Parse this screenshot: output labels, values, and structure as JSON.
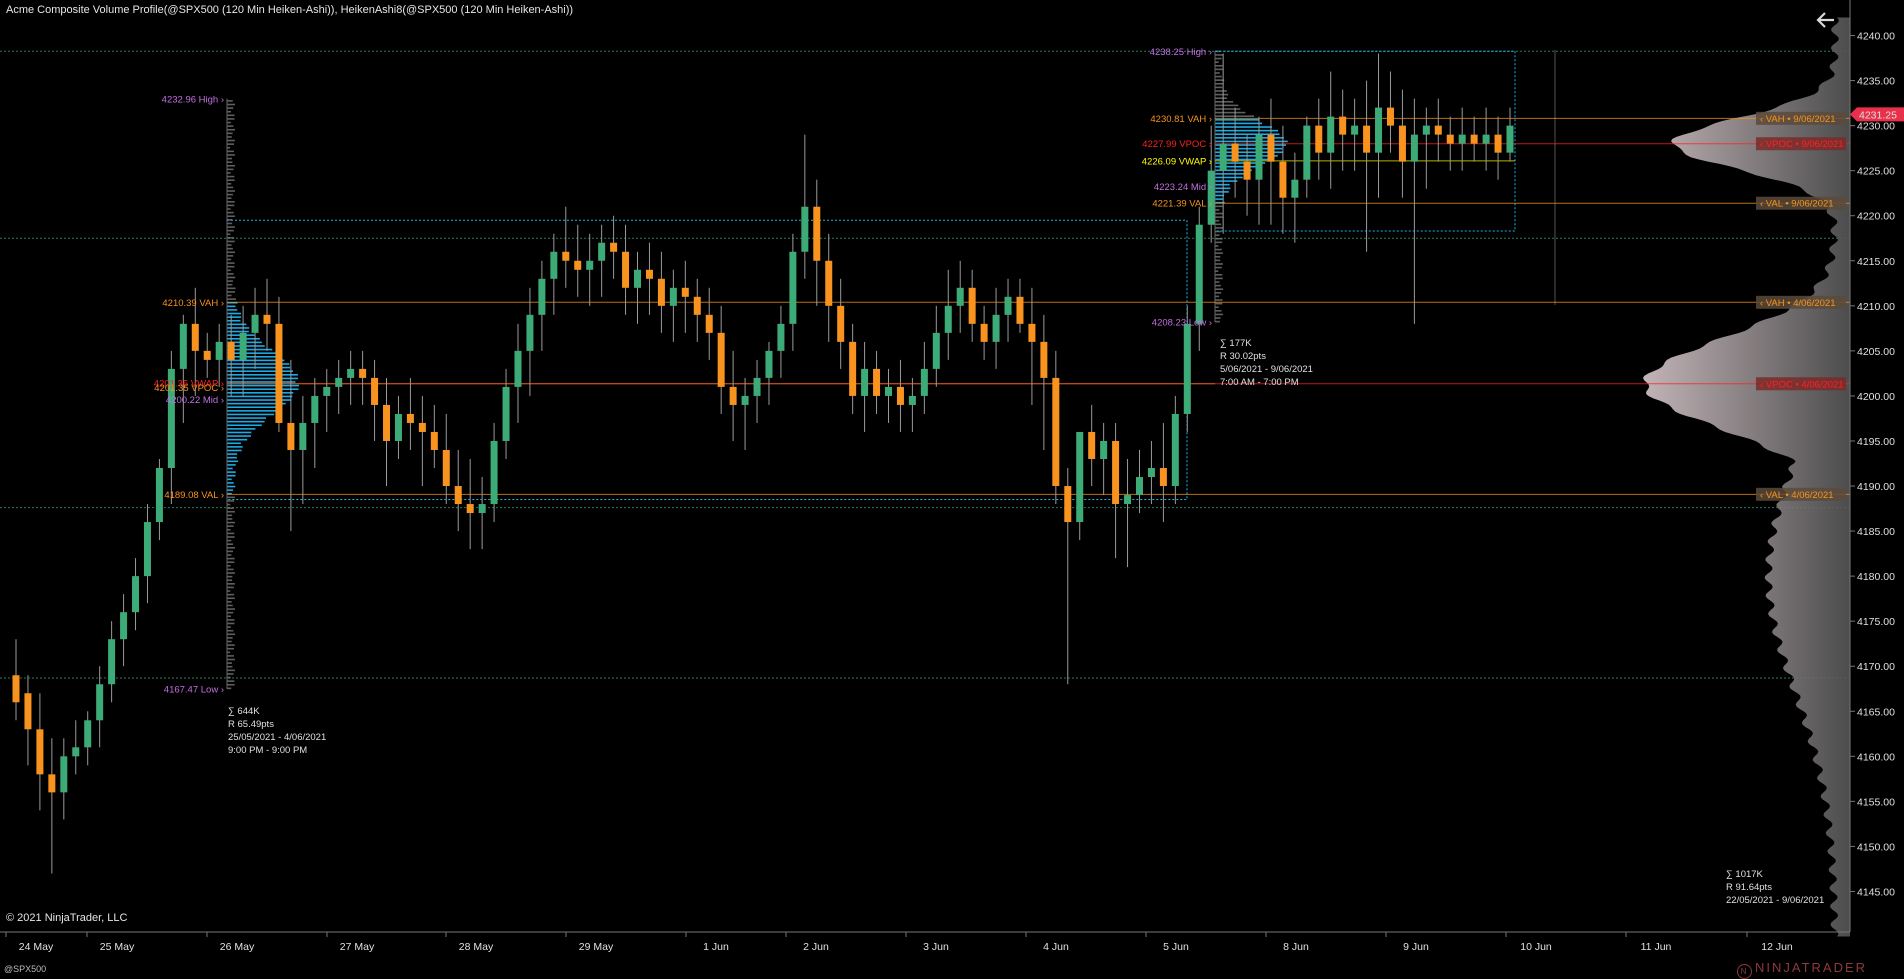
{
  "title": "Acme Composite Volume Profile(@SPX500 (120 Min Heiken-Ashi)), HeikenAshi8(@SPX500 (120 Min Heiken-Ashi))",
  "copyright": "© 2021 NinjaTrader, LLC",
  "instrument": "@SPX500",
  "logo_text": "NINJATRADER",
  "colors": {
    "background": "#000000",
    "bull": "#3dab78",
    "bear": "#f7931e",
    "profile_blue": "#1eb4f0",
    "vah_val": "#f7931e",
    "vpoc": "#ff2020",
    "vwap": "#ffff00",
    "high_low_mid": "#c070e0",
    "price_tag": "#e8304a"
  },
  "chart_data": {
    "type": "candlestick",
    "ylim": [
      4142.5,
      4242.5
    ],
    "y_ticks": [
      "4145.00",
      "4150.00",
      "4155.00",
      "4160.00",
      "4165.00",
      "4170.00",
      "4175.00",
      "4180.00",
      "4185.00",
      "4190.00",
      "4195.00",
      "4200.00",
      "4205.00",
      "4210.00",
      "4215.00",
      "4220.00",
      "4225.00",
      "4230.00",
      "4235.00",
      "4240.00"
    ],
    "x_ticks": [
      "24 May",
      "25 May",
      "26 May",
      "27 May",
      "28 May",
      "29 May",
      "1 Jun",
      "2 Jun",
      "3 Jun",
      "4 Jun",
      "5 Jun",
      "8 Jun",
      "9 Jun",
      "10 Jun",
      "11 Jun",
      "12 Jun"
    ],
    "current_price": "4231.25",
    "profiles": [
      {
        "name": "25/05/2021 - 4/06/2021",
        "high": "4232.96 High",
        "low": "4167.47 Low",
        "vah": "4210.39 VAH",
        "vpoc": "4201.35 VPOC",
        "vwap": "4201.35 VWAP",
        "mid": "4200.22 Mid",
        "val": "4189.08 VAL",
        "volume": "∑ 644K",
        "range": "R 65.49pts",
        "dates": "25/05/2021 - 4/06/2021",
        "hours": "9:00 PM - 9:00 PM",
        "levels": {
          "high": 4232.96,
          "low": 4167.47,
          "vah": 4210.39,
          "vpoc": 4201.35,
          "mid": 4200.22,
          "val": 4189.08
        }
      },
      {
        "name": "5/06/2021 - 9/06/2021",
        "high": "4238.25 High",
        "low": "4208.23 Low",
        "vah": "4230.81 VAH",
        "vpoc": "4227.99 VPOC",
        "vwap": "4226.09 VWAP",
        "mid": "4223.24 Mid",
        "val": "4221.39 VAL",
        "volume": "∑ 177K",
        "range": "R 30.02pts",
        "dates": "5/06/2021 - 9/06/2021",
        "hours": "7:00 AM - 7:00 PM",
        "levels": {
          "high": 4238.25,
          "low": 4208.23,
          "vah": 4230.81,
          "vpoc": 4227.99,
          "vwap": 4226.09,
          "mid": 4223.24,
          "val": 4221.39
        }
      }
    ],
    "composite": {
      "volume": "∑ 1017K",
      "range": "R 91.64pts",
      "dates": "22/05/2021 - 9/06/2021",
      "tags": [
        {
          "text": "VAH • 9/06/2021",
          "value": 4230.81,
          "kind": "vah"
        },
        {
          "text": "VPOC • 9/06/2021",
          "value": 4227.99,
          "kind": "vpoc"
        },
        {
          "text": "VAL • 9/06/2021",
          "value": 4221.39,
          "kind": "val"
        },
        {
          "text": "VAH • 4/06/2021",
          "value": 4210.39,
          "kind": "vah"
        },
        {
          "text": "VPOC • 4/06/2021",
          "value": 4201.35,
          "kind": "vpoc"
        },
        {
          "text": "VAL • 4/06/2021",
          "value": 4189.08,
          "kind": "val"
        }
      ]
    },
    "candles": [
      [
        4169,
        4173,
        4164,
        4166
      ],
      [
        4167,
        4169,
        4159,
        4163
      ],
      [
        4163,
        4167,
        4154,
        4158
      ],
      [
        4158,
        4162,
        4147,
        4156
      ],
      [
        4156,
        4162,
        4153,
        4160
      ],
      [
        4160,
        4164,
        4158,
        4161
      ],
      [
        4161,
        4165,
        4159,
        4164
      ],
      [
        4164,
        4170,
        4161,
        4168
      ],
      [
        4168,
        4175,
        4166,
        4173
      ],
      [
        4173,
        4178,
        4170,
        4176
      ],
      [
        4176,
        4182,
        4174,
        4180
      ],
      [
        4180,
        4188,
        4177,
        4186
      ],
      [
        4186,
        4193,
        4184,
        4192
      ],
      [
        4192,
        4205,
        4188,
        4203
      ],
      [
        4203,
        4209,
        4197,
        4208
      ],
      [
        4208,
        4212,
        4200,
        4205
      ],
      [
        4205,
        4207,
        4202,
        4204
      ],
      [
        4204,
        4208,
        4201,
        4206
      ],
      [
        4206,
        4209,
        4200,
        4204
      ],
      [
        4204,
        4210,
        4200,
        4207
      ],
      [
        4207,
        4212,
        4203,
        4209
      ],
      [
        4209,
        4213,
        4205,
        4208
      ],
      [
        4208,
        4211,
        4196,
        4197
      ],
      [
        4197,
        4204,
        4185,
        4194
      ],
      [
        4194,
        4200,
        4188,
        4197
      ],
      [
        4197,
        4202,
        4192,
        4200
      ],
      [
        4200,
        4203,
        4196,
        4201
      ],
      [
        4201,
        4204,
        4198,
        4202
      ],
      [
        4202,
        4205,
        4199,
        4203
      ],
      [
        4203,
        4205,
        4199,
        4202
      ],
      [
        4202,
        4204,
        4195,
        4199
      ],
      [
        4199,
        4202,
        4190,
        4195
      ],
      [
        4195,
        4200,
        4193,
        4198
      ],
      [
        4198,
        4202,
        4194,
        4197
      ],
      [
        4197,
        4200,
        4190,
        4196
      ],
      [
        4196,
        4199,
        4192,
        4194
      ],
      [
        4194,
        4198,
        4188,
        4190
      ],
      [
        4190,
        4194,
        4185,
        4188
      ],
      [
        4188,
        4193,
        4183,
        4187
      ],
      [
        4187,
        4191,
        4183,
        4188
      ],
      [
        4188,
        4197,
        4186,
        4195
      ],
      [
        4195,
        4203,
        4193,
        4201
      ],
      [
        4201,
        4208,
        4197,
        4205
      ],
      [
        4205,
        4212,
        4200,
        4209
      ],
      [
        4209,
        4215,
        4205,
        4213
      ],
      [
        4213,
        4218,
        4209,
        4216
      ],
      [
        4216,
        4221,
        4212,
        4215
      ],
      [
        4215,
        4219,
        4211,
        4214
      ],
      [
        4214,
        4218,
        4210,
        4215
      ],
      [
        4215,
        4219,
        4211,
        4217
      ],
      [
        4217,
        4220,
        4213,
        4216
      ],
      [
        4216,
        4219,
        4209,
        4212
      ],
      [
        4212,
        4216,
        4208,
        4214
      ],
      [
        4214,
        4217,
        4209,
        4213
      ],
      [
        4213,
        4216,
        4207,
        4210
      ],
      [
        4210,
        4214,
        4206,
        4212
      ],
      [
        4212,
        4215,
        4207,
        4211
      ],
      [
        4211,
        4213,
        4206,
        4209
      ],
      [
        4209,
        4212,
        4204,
        4207
      ],
      [
        4207,
        4210,
        4198,
        4201
      ],
      [
        4201,
        4205,
        4195,
        4199
      ],
      [
        4199,
        4202,
        4194,
        4200
      ],
      [
        4200,
        4204,
        4197,
        4202
      ],
      [
        4202,
        4206,
        4199,
        4205
      ],
      [
        4205,
        4210,
        4202,
        4208
      ],
      [
        4208,
        4218,
        4205,
        4216
      ],
      [
        4216,
        4229,
        4213,
        4221
      ],
      [
        4221,
        4224,
        4210,
        4215
      ],
      [
        4215,
        4218,
        4206,
        4210
      ],
      [
        4210,
        4213,
        4203,
        4206
      ],
      [
        4206,
        4208,
        4198,
        4200
      ],
      [
        4200,
        4206,
        4196,
        4203
      ],
      [
        4203,
        4205,
        4198,
        4200
      ],
      [
        4200,
        4203,
        4197,
        4201
      ],
      [
        4201,
        4204,
        4196,
        4199
      ],
      [
        4199,
        4202,
        4196,
        4200
      ],
      [
        4200,
        4206,
        4198,
        4203
      ],
      [
        4203,
        4210,
        4201,
        4207
      ],
      [
        4207,
        4214,
        4204,
        4210
      ],
      [
        4210,
        4215,
        4207,
        4212
      ],
      [
        4212,
        4214,
        4206,
        4208
      ],
      [
        4208,
        4210,
        4204,
        4206
      ],
      [
        4206,
        4212,
        4203,
        4209
      ],
      [
        4209,
        4213,
        4206,
        4211
      ],
      [
        4211,
        4213,
        4207,
        4208
      ],
      [
        4208,
        4212,
        4199,
        4206
      ],
      [
        4206,
        4209,
        4194,
        4202
      ],
      [
        4202,
        4205,
        4188,
        4190
      ],
      [
        4190,
        4192,
        4168,
        4186
      ],
      [
        4186,
        4194,
        4184,
        4196
      ],
      [
        4196,
        4199,
        4190,
        4193
      ],
      [
        4193,
        4197,
        4189,
        4195
      ],
      [
        4195,
        4197,
        4182,
        4188
      ],
      [
        4188,
        4193,
        4181,
        4189
      ],
      [
        4189,
        4194,
        4187,
        4191
      ],
      [
        4191,
        4195,
        4188,
        4192
      ],
      [
        4192,
        4197,
        4186,
        4190
      ],
      [
        4190,
        4200,
        4188,
        4198
      ],
      [
        4198,
        4210,
        4196,
        4208
      ],
      [
        4208,
        4221,
        4205,
        4219
      ],
      [
        4219,
        4230,
        4217,
        4225
      ],
      [
        4225,
        4238,
        4218,
        4228
      ],
      [
        4228,
        4232,
        4222,
        4226
      ],
      [
        4226,
        4229,
        4220,
        4224
      ],
      [
        4224,
        4231,
        4219,
        4229
      ],
      [
        4229,
        4233,
        4219,
        4226
      ],
      [
        4226,
        4230,
        4218,
        4222
      ],
      [
        4222,
        4227,
        4217,
        4224
      ],
      [
        4224,
        4231,
        4222,
        4230
      ],
      [
        4230,
        4233,
        4224,
        4227
      ],
      [
        4227,
        4236,
        4223,
        4231
      ],
      [
        4231,
        4234,
        4225,
        4229
      ],
      [
        4229,
        4233,
        4225,
        4230
      ],
      [
        4230,
        4235,
        4216,
        4227
      ],
      [
        4227,
        4238,
        4222,
        4232
      ],
      [
        4232,
        4236,
        4227,
        4230
      ],
      [
        4230,
        4234,
        4222,
        4226
      ],
      [
        4226,
        4233,
        4208,
        4229
      ],
      [
        4229,
        4232,
        4223,
        4230
      ],
      [
        4230,
        4233,
        4226,
        4229
      ],
      [
        4229,
        4231,
        4225,
        4228
      ],
      [
        4228,
        4232,
        4225,
        4229
      ],
      [
        4229,
        4231,
        4226,
        4228
      ],
      [
        4228,
        4232,
        4225,
        4229
      ],
      [
        4229,
        4231,
        4224,
        4227
      ],
      [
        4227,
        4232,
        4226,
        4230
      ]
    ]
  }
}
